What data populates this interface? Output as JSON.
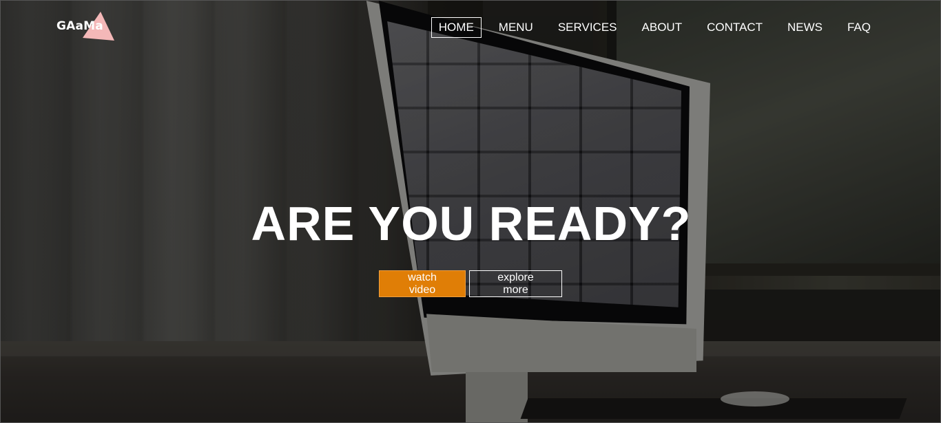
{
  "brand": {
    "logo_text": "GAaMa",
    "logo_color": "#f4b8b8"
  },
  "nav": {
    "items": [
      {
        "label": "HOME",
        "active": true
      },
      {
        "label": "MENU",
        "active": false
      },
      {
        "label": "SERVICES",
        "active": false
      },
      {
        "label": "ABOUT",
        "active": false
      },
      {
        "label": "CONTACT",
        "active": false
      },
      {
        "label": "NEWS",
        "active": false
      },
      {
        "label": "FAQ",
        "active": false
      }
    ]
  },
  "hero": {
    "headline": "ARE YOU READY?",
    "primary_button": "watch video",
    "secondary_button": "explore more",
    "accent_color": "#e07e06",
    "background_image": "imac-desk-photo"
  }
}
